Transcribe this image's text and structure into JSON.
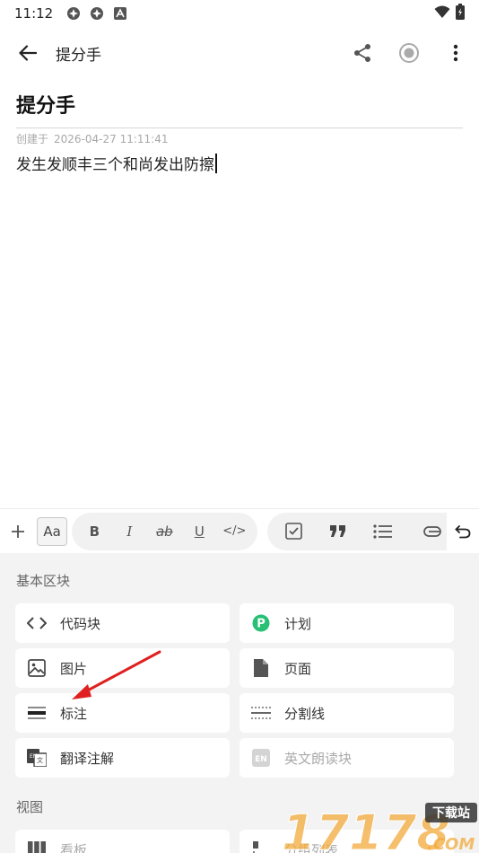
{
  "status_bar": {
    "time": "11:12"
  },
  "app_bar": {
    "title": "提分手"
  },
  "document": {
    "title": "提分手",
    "created_label": "创建于",
    "created_time": "2026-04-27 11:11:41",
    "body": "发生发顺丰三个和尚发出防擦"
  },
  "toolbar": {
    "aa_label": "Aa",
    "bold": "B",
    "italic": "I",
    "strike": "ab",
    "underline": "U",
    "code": "</>"
  },
  "sections": {
    "basic": "基本区块",
    "view": "视图"
  },
  "blocks": {
    "code": "代码块",
    "plan": "计划",
    "image": "图片",
    "page": "页面",
    "callout": "标注",
    "divider": "分割线",
    "translate": "翻译注解",
    "english_read": "英文朗读块",
    "kanban": "看板",
    "group_list": "分组列表"
  },
  "watermark": {
    "text": "17178",
    "sub": "下载站",
    "domain": ".COM"
  }
}
